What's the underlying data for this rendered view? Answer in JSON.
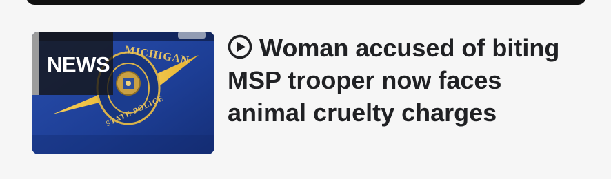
{
  "story": {
    "headline": "Woman accused of biting MSP trooper now faces animal cruelty charges",
    "badge_label": "NEWS",
    "media_type_icon": "play-circle-icon",
    "thumbnail": {
      "badge_text_top": "MICHIGAN",
      "badge_text_bottom": "STATE POLICE",
      "colors": {
        "car_blue": "#1e3f96",
        "stripe_gold": "#f2c23c"
      }
    }
  },
  "colors": {
    "page_background": "#f6f6f6",
    "top_bar": "#111111",
    "headline_text": "#202124",
    "badge_overlay": "#141414"
  }
}
